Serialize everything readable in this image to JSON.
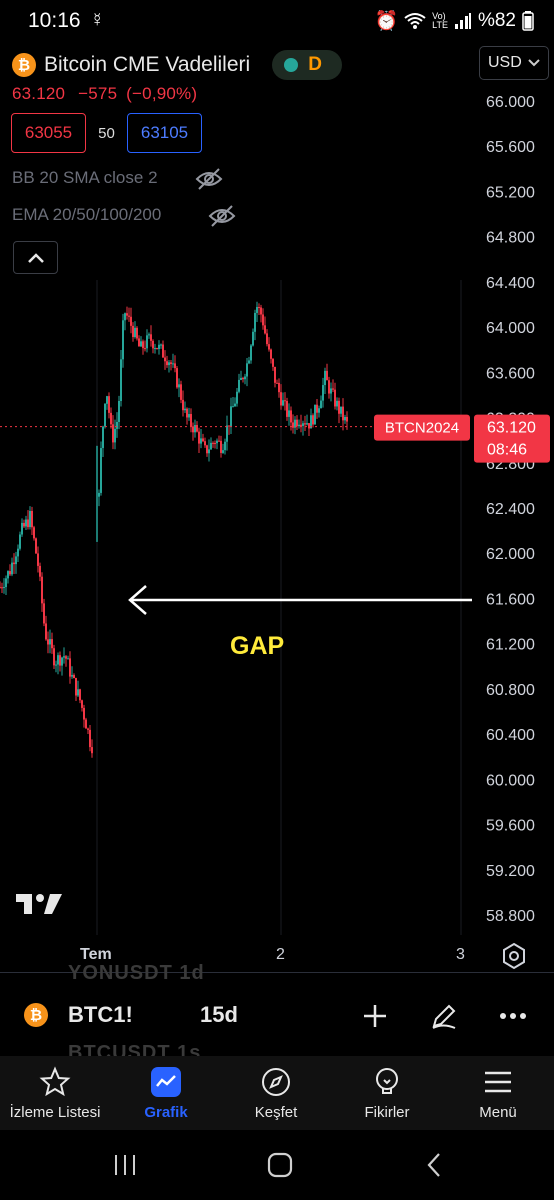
{
  "status_bar": {
    "time": "10:16",
    "battery_text": "%82"
  },
  "header": {
    "title": "Bitcoin CME Vadelileri",
    "status_letter": "D",
    "currency": "USD"
  },
  "quote": {
    "last": "63.120",
    "change": "−575",
    "change_pct": "(−0,90%)",
    "bid": "63055",
    "spread": "50",
    "ask": "63105"
  },
  "indicators": [
    {
      "label": "BB 20 SMA close 2"
    },
    {
      "label": "EMA 20/50/100/200"
    }
  ],
  "price_scale": [
    "66.000",
    "65.600",
    "65.200",
    "64.800",
    "64.400",
    "64.000",
    "63.600",
    "63.200",
    "62.800",
    "62.400",
    "62.000",
    "61.600",
    "61.200",
    "60.800",
    "60.400",
    "60.000",
    "59.600",
    "59.200",
    "58.800"
  ],
  "price_badge": {
    "symbol": "BTCN2024",
    "price": "63.120",
    "countdown": "08:46"
  },
  "annotation": {
    "text": "GAP",
    "color": "#ffeb3b"
  },
  "time_axis": [
    {
      "label": "Tem",
      "bold": true
    },
    {
      "label": "2",
      "bold": false
    },
    {
      "label": "3",
      "bold": false
    }
  ],
  "ghost_rows": [
    "YONUSDT  1d",
    "BTCUSDT  1s"
  ],
  "toolbar": {
    "symbol": "BTC1!",
    "interval": "15d"
  },
  "bottom_nav": [
    {
      "label": "İzleme Listesi",
      "icon": "star-icon",
      "active": false
    },
    {
      "label": "Grafik",
      "icon": "chart-icon",
      "active": true
    },
    {
      "label": "Keşfet",
      "icon": "compass-icon",
      "active": false
    },
    {
      "label": "Fikirler",
      "icon": "bulb-icon",
      "active": false
    },
    {
      "label": "Menü",
      "icon": "menu-icon",
      "active": false
    }
  ],
  "colors": {
    "up": "#26a69a",
    "down": "#f23645",
    "accent": "#2962ff",
    "btc": "#f7931a"
  },
  "chart_data": {
    "type": "candlestick",
    "interval": "15d",
    "y_axis_range": [
      58600,
      66200
    ],
    "last_price": 63120,
    "segments": [
      {
        "from": 60250,
        "to": 62100,
        "hi": 62350,
        "lo": 60200,
        "n": 45,
        "bias": "up-then-down"
      },
      {
        "from": 60150,
        "to": 60300,
        "hi": 60500,
        "lo": 60200,
        "n": 0,
        "bias": "gap"
      },
      {
        "from": 62100,
        "to": 63400,
        "hi": 64350,
        "lo": 62050,
        "n": 35,
        "bias": "rally"
      },
      {
        "from": 63400,
        "to": 63000,
        "hi": 63500,
        "lo": 62850,
        "n": 25,
        "bias": "chop"
      },
      {
        "from": 63000,
        "to": 64300,
        "hi": 64350,
        "lo": 62900,
        "n": 18,
        "bias": "rally"
      },
      {
        "from": 64300,
        "to": 63100,
        "hi": 64300,
        "lo": 62950,
        "n": 30,
        "bias": "down"
      }
    ]
  }
}
